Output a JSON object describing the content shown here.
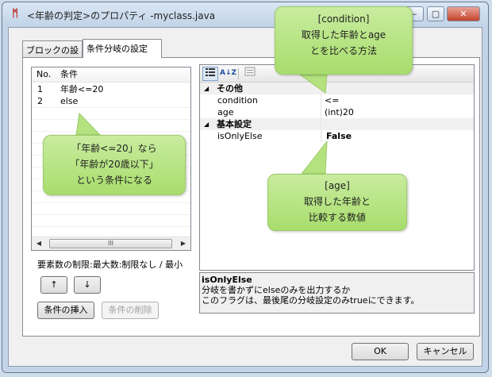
{
  "window": {
    "title": "<年齢の判定>のプロパティ -myclass.java",
    "icon": "app-logo-icon"
  },
  "caption_buttons": {
    "minimize": "‒",
    "maximize": "▢",
    "close": "✕"
  },
  "tabs": [
    {
      "label": "ブロックの設定",
      "active": false
    },
    {
      "label": "条件分岐の設定",
      "active": true
    }
  ],
  "condition_list": {
    "headers": [
      "No.",
      "条件"
    ],
    "rows": [
      {
        "no": "1",
        "condition": "年齢<=20"
      },
      {
        "no": "2",
        "condition": "else"
      }
    ],
    "scroll_left": "◀",
    "scroll_right": "▶",
    "thumb_grip": "III"
  },
  "limit_text": "要素数の制限:最大数:制限なし / 最小",
  "move_up": "↑",
  "move_down": "↓",
  "insert_button": "条件の挿入",
  "delete_button": "条件の削除",
  "property_grid": {
    "toolbar": [
      "categorized-icon",
      "sort-az-icon",
      "property-pages-icon"
    ],
    "sort_glyph": "A↓Z",
    "categories": [
      {
        "name": "その他",
        "rows": [
          {
            "name": "condition",
            "value": "<="
          },
          {
            "name": "age",
            "value": "(int)20"
          }
        ]
      },
      {
        "name": "基本設定",
        "rows": [
          {
            "name": "isOnlyElse",
            "value": "False"
          }
        ]
      }
    ],
    "expand_glyph": "◢"
  },
  "description": {
    "title": "isOnlyElse",
    "line1": "分岐を書かずにelseのみを出力するか",
    "line2": "このフラグは、最後尾の分岐設定のみtrueにできます。"
  },
  "ok_button": "OK",
  "cancel_button": "キャンセル",
  "callouts": {
    "condition": {
      "line1": "[condition]",
      "line2": "取得した年齢とage",
      "line3": "とを比べる方法"
    },
    "row_note": {
      "line1": "「年齢<=20」なら",
      "line2": "「年齢が20歳以下」",
      "line3": "という条件になる"
    },
    "age": {
      "line1": "[age]",
      "line2": "取得した年齢と",
      "line3": "比較する数値"
    }
  },
  "colors": {
    "callout_fill": "#b4e27f",
    "accent_close": "#c4432c"
  }
}
